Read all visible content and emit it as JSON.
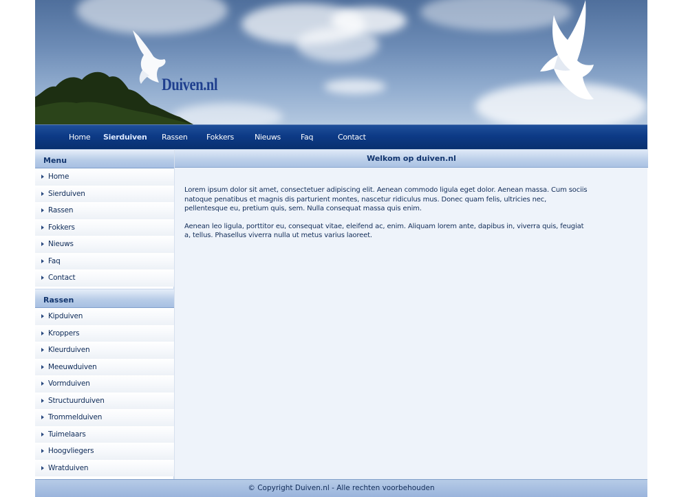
{
  "site": {
    "logo_text": "Duiven.nl"
  },
  "topnav": {
    "items": [
      "Home",
      "Sierduiven",
      "Rassen",
      "Fokkers",
      "Nieuws",
      "Faq",
      "Contact"
    ]
  },
  "sidebar": {
    "menu_title": "Menu",
    "menu_items": [
      "Home",
      "Sierduiven",
      "Rassen",
      "Fokkers",
      "Nieuws",
      "Faq",
      "Contact"
    ],
    "rassen_title": "Rassen",
    "rassen_items": [
      "Kipduiven",
      "Kroppers",
      "Kleurduiven",
      "Meeuwduiven",
      "Vormduiven",
      "Structuurduiven",
      "Trommelduiven",
      "Tuimelaars",
      "Hoogvliegers",
      "Wratduiven"
    ]
  },
  "main": {
    "title": "Welkom op duiven.nl",
    "paragraphs": [
      "Lorem ipsum dolor sit amet, consectetuer adipiscing elit. Aenean commodo ligula eget dolor. Aenean massa. Cum sociis natoque penatibus et magnis dis parturient montes, nascetur ridiculus mus. Donec quam felis, ultricies nec, pellentesque eu, pretium quis, sem. Nulla consequat massa quis enim.",
      "Aenean leo ligula, porttitor eu, consequat vitae, eleifend ac, enim. Aliquam lorem ante, dapibus in, viverra quis, feugiat a, tellus. Phasellus viverra nulla ut metus varius laoreet."
    ]
  },
  "footer": {
    "text": "© Copyright Duiven.nl - Alle rechten voorbehouden"
  },
  "colors": {
    "nav_blue": "#0d3a86",
    "header_text": "#12356e",
    "logo_blue": "#1f3f8e",
    "content_bg": "#eef3fa"
  },
  "icons": {
    "banner_doves": "dove-icon",
    "list_bullet": "triangle-right-icon"
  }
}
